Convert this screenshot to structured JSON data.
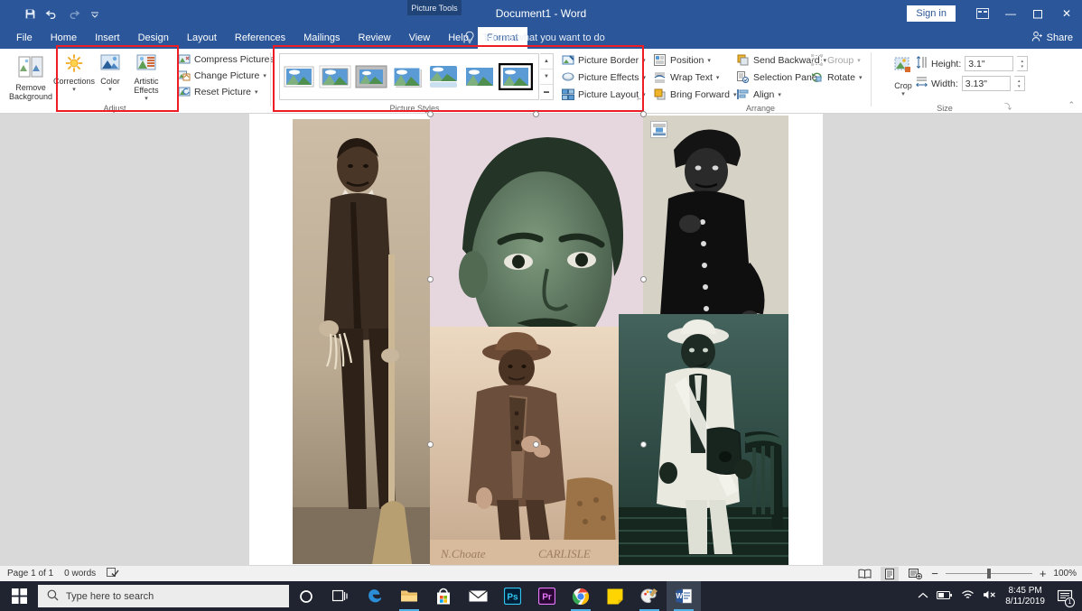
{
  "titlebar": {
    "quick_access": [
      {
        "name": "save",
        "icon": "save-icon"
      },
      {
        "name": "undo",
        "icon": "undo-icon"
      },
      {
        "name": "redo",
        "icon": "redo-icon"
      },
      {
        "name": "customize",
        "icon": "chevron-down-icon"
      }
    ],
    "contextual_tab_label": "Picture Tools",
    "document_title": "Document1  -  Word",
    "sign_in": "Sign in",
    "ribbon_display_options": "ribbon-display-options-icon",
    "minimize": "—",
    "maximize": "❐",
    "close": "✕"
  },
  "tabs": [
    {
      "label": "File",
      "active": false
    },
    {
      "label": "Home",
      "active": false
    },
    {
      "label": "Insert",
      "active": false
    },
    {
      "label": "Design",
      "active": false
    },
    {
      "label": "Layout",
      "active": false
    },
    {
      "label": "References",
      "active": false
    },
    {
      "label": "Mailings",
      "active": false
    },
    {
      "label": "Review",
      "active": false
    },
    {
      "label": "View",
      "active": false
    },
    {
      "label": "Help",
      "active": false
    },
    {
      "label": "Format",
      "active": true
    }
  ],
  "tell_me": "Tell me what you want to do",
  "share": "Share",
  "ribbon": {
    "adjust": {
      "group_label": "Adjust",
      "remove_background": "Remove Background",
      "buttons": [
        {
          "label": "Corrections",
          "icon": "brightness-sun-icon"
        },
        {
          "label": "Color",
          "icon": "color-picture-icon"
        },
        {
          "label": "Artistic Effects",
          "icon": "artistic-effects-icon"
        }
      ],
      "commands": [
        {
          "label": "Compress Pictures",
          "icon": "compress-pictures-icon",
          "caret": false
        },
        {
          "label": "Change Picture",
          "icon": "change-picture-icon",
          "caret": true
        },
        {
          "label": "Reset Picture",
          "icon": "reset-picture-icon",
          "caret": true
        }
      ]
    },
    "picture_styles": {
      "group_label": "Picture Styles",
      "gallery": [
        {
          "name": "simple-frame-white",
          "selected": false
        },
        {
          "name": "beveled-matte-white",
          "selected": false
        },
        {
          "name": "metal-frame",
          "selected": false
        },
        {
          "name": "drop-shadow-rectangle",
          "selected": false
        },
        {
          "name": "reflected-rounded-rectangle",
          "selected": false
        },
        {
          "name": "soft-edge-rectangle",
          "selected": false
        },
        {
          "name": "thick-matte-black",
          "selected": true
        }
      ],
      "scroll_up": "▲",
      "scroll_down": "▼",
      "more": "▼",
      "commands": [
        {
          "label": "Picture Border",
          "icon": "picture-border-icon",
          "caret": true
        },
        {
          "label": "Picture Effects",
          "icon": "picture-effects-icon",
          "caret": true
        },
        {
          "label": "Picture Layout",
          "icon": "picture-layout-icon",
          "caret": true
        }
      ]
    },
    "arrange": {
      "group_label": "Arrange",
      "col1": [
        {
          "label": "Position",
          "icon": "position-icon",
          "caret": true,
          "disabled": false
        },
        {
          "label": "Wrap Text",
          "icon": "wrap-text-icon",
          "caret": true,
          "disabled": false
        },
        {
          "label": "Bring Forward",
          "icon": "bring-forward-icon",
          "caret": true,
          "disabled": false
        }
      ],
      "col2": [
        {
          "label": "Send Backward",
          "icon": "send-backward-icon",
          "caret": true,
          "disabled": false
        },
        {
          "label": "Selection Pane",
          "icon": "selection-pane-icon",
          "caret": false,
          "disabled": false
        },
        {
          "label": "Align",
          "icon": "align-icon",
          "caret": true,
          "disabled": false
        }
      ],
      "col3": [
        {
          "label": "Group",
          "icon": "group-icon",
          "caret": true,
          "disabled": true
        },
        {
          "label": "Rotate",
          "icon": "rotate-icon",
          "caret": true,
          "disabled": false
        }
      ]
    },
    "size": {
      "group_label": "Size",
      "crop": "Crop",
      "height_label": "Height:",
      "height_value": "3.1\"",
      "width_label": "Width:",
      "width_value": "3.13\"",
      "dialog_launcher": "⤵"
    },
    "collapse": "⌃"
  },
  "annotations": {
    "highlight_color": "#ee1c25",
    "boxes": [
      {
        "name": "adjust-group-highlight"
      },
      {
        "name": "picture-styles-group-highlight"
      }
    ]
  },
  "document": {
    "anchor_icon": "anchor-icon",
    "layout_options_icon": "layout-options-icon",
    "photos": [
      {
        "name": "portrait-man-with-broom",
        "tint": "sepia",
        "selected": false
      },
      {
        "name": "portrait-man-closeup-green",
        "tint": "green",
        "selected": true
      },
      {
        "name": "portrait-man-with-basket",
        "tint": "gray",
        "selected": false
      },
      {
        "name": "portrait-young-man-hat-sepia",
        "tint": "sepia-pink",
        "selected": false
      },
      {
        "name": "portrait-man-with-chair-teal",
        "tint": "teal",
        "selected": false
      }
    ],
    "selection_handles": 8
  },
  "statusbar": {
    "page": "Page 1 of 1",
    "words": "0 words",
    "proofing_icon": "proofing-errors-icon",
    "views": [
      {
        "name": "read-mode",
        "active": false
      },
      {
        "name": "print-layout",
        "active": true
      },
      {
        "name": "web-layout",
        "active": false
      }
    ],
    "zoom_out": "−",
    "zoom_in": "+",
    "zoom_level": "100%"
  },
  "taskbar": {
    "start_icon": "windows-start-icon",
    "search_placeholder": "Type here to search",
    "search_icon": "search-icon",
    "cortana_icon": "cortana-icon",
    "task_view_icon": "task-view-icon",
    "apps": [
      {
        "name": "edge",
        "label": "e",
        "running": false
      },
      {
        "name": "file-explorer",
        "label": "",
        "running": true
      },
      {
        "name": "microsoft-store",
        "label": "",
        "running": false
      },
      {
        "name": "mail",
        "label": "",
        "running": false
      },
      {
        "name": "photoshop",
        "label": "Ps",
        "running": false
      },
      {
        "name": "premiere-pro",
        "label": "Pr",
        "running": false
      },
      {
        "name": "chrome",
        "label": "",
        "running": true
      },
      {
        "name": "sticky-notes",
        "label": "",
        "running": false
      },
      {
        "name": "paint-3d",
        "label": "",
        "running": true
      },
      {
        "name": "word",
        "label": "W",
        "running": true,
        "active": true
      }
    ],
    "tray": {
      "show_hidden_icons": "⌃",
      "battery_icon": "battery-icon",
      "network_icon": "wifi-icon",
      "volume_icon": "volume-muted-icon",
      "time": "8:45 PM",
      "date": "8/11/2019",
      "notification_icon": "action-center-icon",
      "notification_count": "1"
    }
  }
}
